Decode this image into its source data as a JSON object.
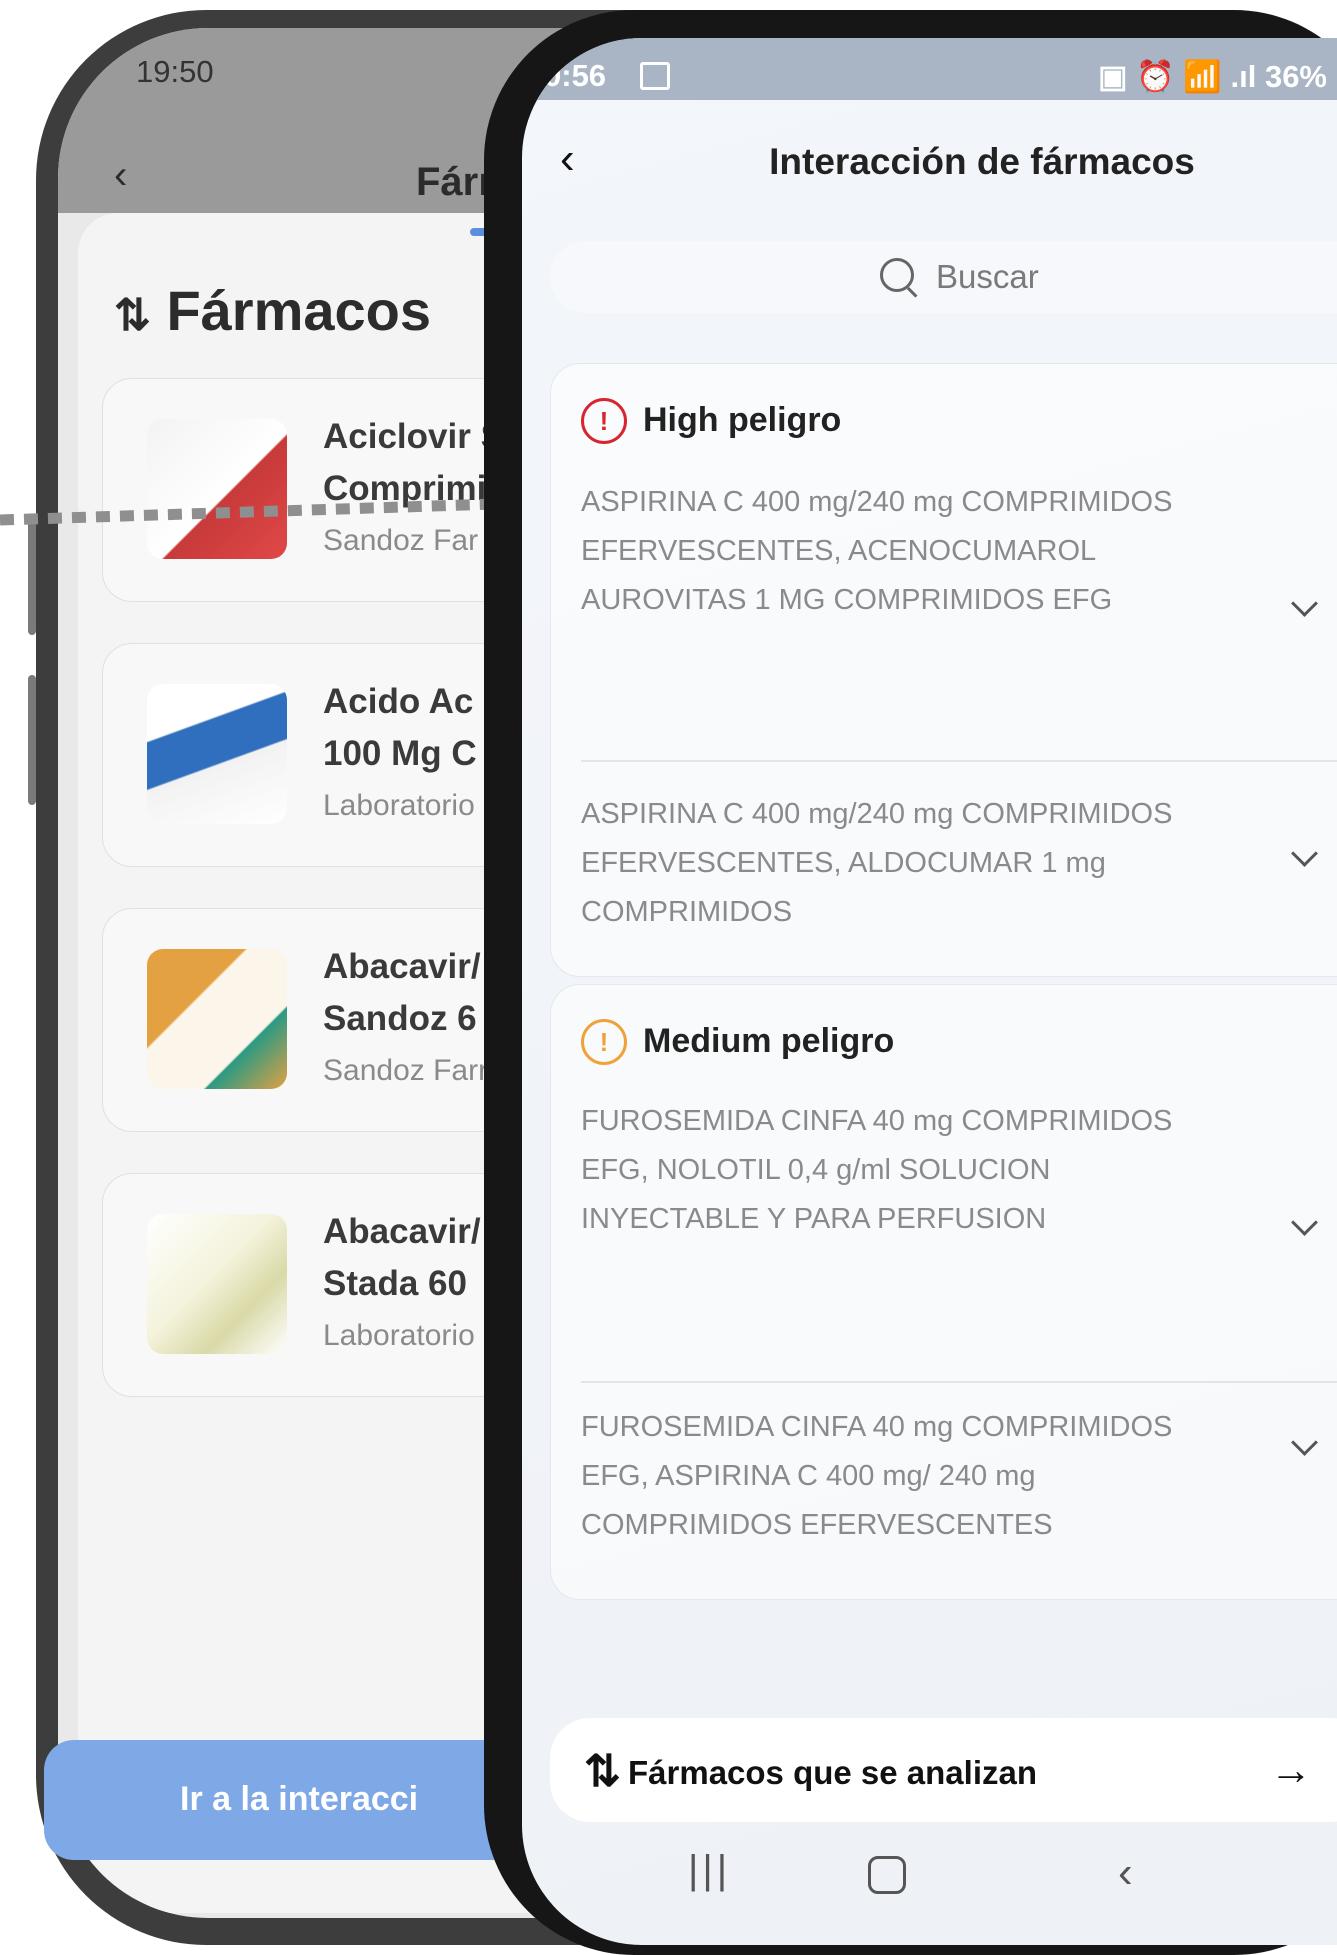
{
  "back_screen": {
    "status_time": "19:50",
    "header_title": "Fárı",
    "heading": "Fármacos",
    "sort_icon": "sort-arrows-icon",
    "cards": [
      {
        "line1": "Aciclovir S",
        "line2": "Comprimi",
        "sub": "Sandoz Far",
        "pkg_color": "#c83a3a"
      },
      {
        "line1": "Acido Ac",
        "line2": "100 Mg C",
        "sub": "Laboratorio",
        "pkg_color": "#2f6fbd"
      },
      {
        "line1": "Abacavir/",
        "line2": "Sandoz 6",
        "sub": "Sandoz Farr",
        "pkg_color": "#e3a141"
      },
      {
        "line1": "Abacavir/",
        "line2": "Stada 60",
        "sub": "Laboratorio",
        "pkg_color": "#d9d9a8"
      }
    ],
    "cta_label": "Ir a la interacci"
  },
  "front_screen": {
    "status_time": "0:56",
    "status_right": "▣ ⏰ 📶 .ıl 36%",
    "header_title": "Interacción de fármacos",
    "search_placeholder": "Buscar",
    "high_panel": {
      "title": "High peligro",
      "icon_color": "#d7262f",
      "items": [
        {
          "text": "ASPIRINA C 400 mg/240 mg COMPRIMIDOS EFERVESCENTES, ACENOCUMAROL AUROVITAS 1 MG COMPRIMIDOS EFG"
        },
        {
          "text": "ASPIRINA C 400 mg/240 mg COMPRIMIDOS EFERVESCENTES, ALDOCUMAR 1 mg COMPRIMIDOS"
        }
      ]
    },
    "medium_panel": {
      "title": "Medium peligro",
      "icon_color": "#f0a23a",
      "items": [
        {
          "text": "FUROSEMIDA CINFA 40 mg COMPRIMIDOS EFG, NOLOTIL 0,4 g/ml SOLUCION INYECTABLE Y PARA PERFUSION"
        },
        {
          "text": "FUROSEMIDA CINFA 40 mg COMPRIMIDOS EFG, ASPIRINA C 400 mg/ 240 mg COMPRIMIDOS EFERVESCENTES"
        }
      ]
    },
    "bottom_button": {
      "label": "Fármacos que se analizan",
      "icon": "sort-arrows-icon",
      "arrow": "arrow-right-icon"
    },
    "nav": {
      "recent": "recent-apps-icon",
      "home": "home-icon",
      "back": "back-icon"
    }
  }
}
